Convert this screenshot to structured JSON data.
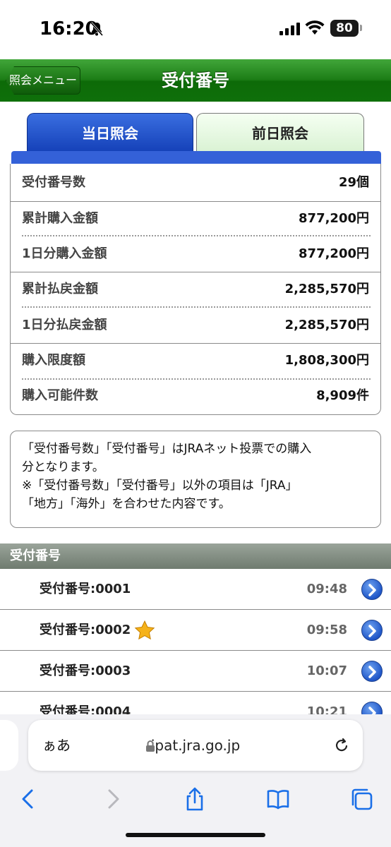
{
  "status_bar": {
    "time": "16:20",
    "battery": "80"
  },
  "header": {
    "back_label": "照会メニュー",
    "title": "受付番号"
  },
  "tabs": [
    {
      "label": "当日照会",
      "active": true
    },
    {
      "label": "前日照会",
      "active": false
    }
  ],
  "summary": [
    {
      "label": "受付番号数",
      "value": "29個"
    },
    {
      "label": "累計購入金額",
      "value": "877,200円"
    },
    {
      "label": "1日分購入金額",
      "value": "877,200円"
    },
    {
      "label": "累計払戻金額",
      "value": "2,285,570円"
    },
    {
      "label": "1日分払戻金額",
      "value": "2,285,570円"
    },
    {
      "label": "購入限度額",
      "value": "1,808,300円"
    },
    {
      "label": "購入可能件数",
      "value": "8,909件"
    }
  ],
  "note": {
    "line1": "「受付番号数」「受付番号」はJRAネット投票での購入",
    "line2": "分となります。",
    "line3": "※「受付番号数」「受付番号」以外の項目は「JRA」",
    "line4": "「地方」「海外」を合わせた内容です。"
  },
  "section_title": "受付番号",
  "receipts": [
    {
      "label": "受付番号:0001",
      "time": "09:48",
      "starred": false
    },
    {
      "label": "受付番号:0002",
      "time": "09:58",
      "starred": true
    },
    {
      "label": "受付番号:0003",
      "time": "10:07",
      "starred": false
    },
    {
      "label": "受付番号:0004",
      "time": "10:21",
      "starred": false
    }
  ],
  "browser": {
    "aa": "ぁあ",
    "url": "ipat.jra.go.jp"
  },
  "colors": {
    "header_green": "#1c7d16",
    "tab_blue": "#1440b8",
    "chevron_blue": "#1f56c8"
  }
}
